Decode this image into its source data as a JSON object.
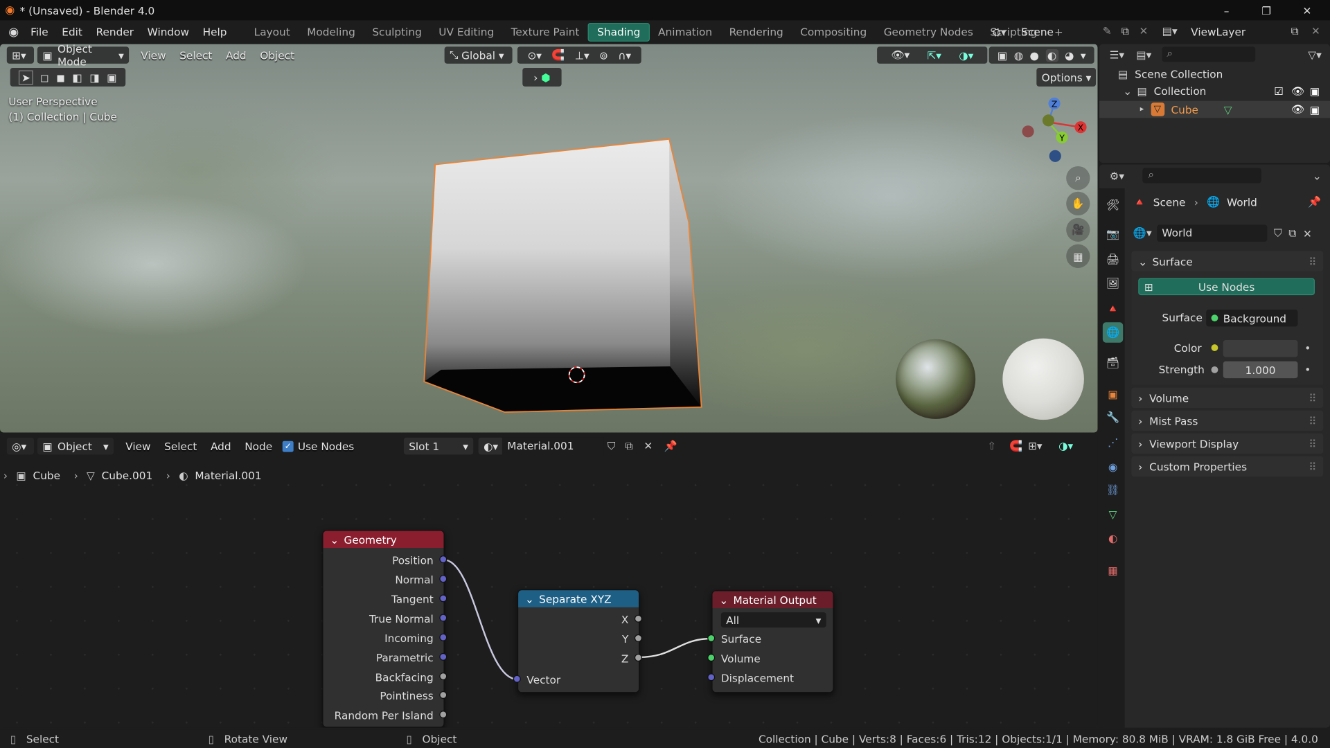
{
  "window": {
    "title": "* (Unsaved) - Blender 4.0"
  },
  "menu": [
    "File",
    "Edit",
    "Render",
    "Window",
    "Help"
  ],
  "workspaces": {
    "tabs": [
      "Layout",
      "Modeling",
      "Sculpting",
      "UV Editing",
      "Texture Paint",
      "Shading",
      "Animation",
      "Rendering",
      "Compositing",
      "Geometry Nodes",
      "Scripting"
    ],
    "active": "Shading",
    "add": "+"
  },
  "scene": {
    "name": "Scene",
    "view_layer": "ViewLayer"
  },
  "viewport": {
    "mode": "Object Mode",
    "menus": [
      "View",
      "Select",
      "Add",
      "Object"
    ],
    "orientation": "Global",
    "options_label": "Options",
    "perspective": "User Perspective",
    "collection_info": "(1) Collection | Cube",
    "gizmo_axes": {
      "x": "X",
      "y": "Y",
      "z": "Z"
    }
  },
  "node_editor": {
    "editor_type": "Object",
    "menus": [
      "View",
      "Select",
      "Add",
      "Node"
    ],
    "use_nodes_label": "Use Nodes",
    "use_nodes": true,
    "slot": "Slot 1",
    "material": "Material.001",
    "breadcrumb": [
      "Cube",
      "Cube.001",
      "Material.001"
    ],
    "nodes": {
      "geometry": {
        "title": "Geometry",
        "outputs": [
          "Position",
          "Normal",
          "Tangent",
          "True Normal",
          "Incoming",
          "Parametric",
          "Backfacing",
          "Pointiness",
          "Random Per Island"
        ]
      },
      "separate": {
        "title": "Separate XYZ",
        "outputs": [
          "X",
          "Y",
          "Z"
        ],
        "input": "Vector"
      },
      "output": {
        "title": "Material Output",
        "target": "All",
        "inputs": [
          "Surface",
          "Volume",
          "Displacement"
        ]
      }
    }
  },
  "outliner": {
    "root": "Scene Collection",
    "collection": "Collection",
    "object": "Cube"
  },
  "properties": {
    "breadcrumb": [
      "Scene",
      "World"
    ],
    "world_name": "World",
    "surface_panel": "Surface",
    "use_nodes_label": "Use Nodes",
    "surface_label": "Surface",
    "surface_value": "Background",
    "color_label": "Color",
    "strength_label": "Strength",
    "strength_value": "1.000",
    "collapsed_panels": [
      "Volume",
      "Mist Pass",
      "Viewport Display",
      "Custom Properties"
    ]
  },
  "statusbar": {
    "hints": [
      "Select",
      "Rotate View",
      "Object"
    ],
    "stats": "Collection | Cube | Verts:8 | Faces:6 | Tris:12 | Objects:1/1 | Memory: 80.8 MiB | VRAM: 1.8 GiB Free | 4.0.0"
  },
  "colors": {
    "accent": "#1f6d5a",
    "selection": "#e8853a",
    "geometry_header": "#8b1e2e",
    "separate_header": "#1e5f86",
    "output_header": "#6b1d2a",
    "socket_vector": "#6363c7",
    "socket_float": "#a1a1a1",
    "socket_shader": "#4cd26b"
  }
}
